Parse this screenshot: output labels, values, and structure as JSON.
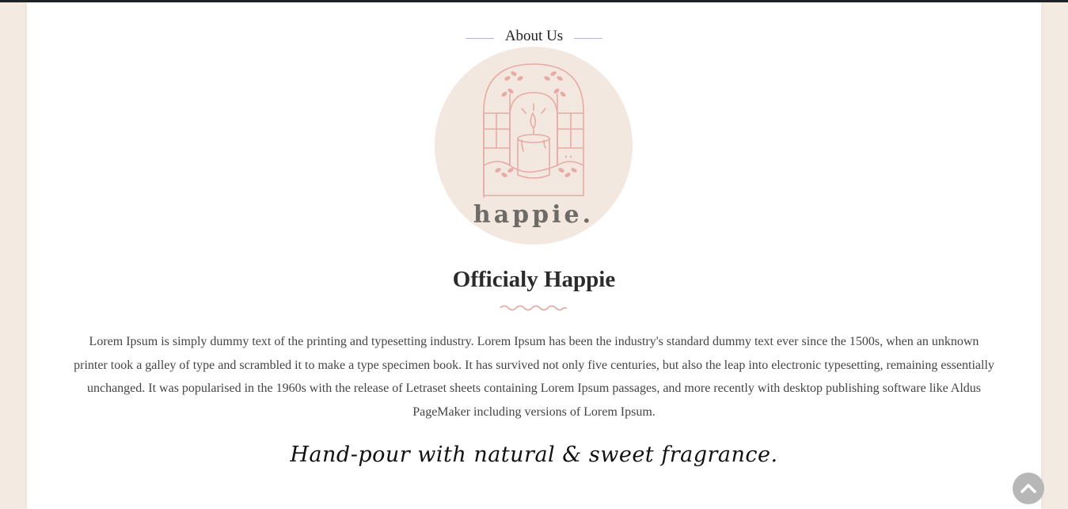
{
  "about": {
    "section_label": "About Us",
    "logo_wordmark": "happie.",
    "title": "Officialy Happie",
    "body": "Lorem Ipsum is simply dummy text of the printing and typesetting industry. Lorem Ipsum has been the industry's standard dummy text ever since the 1500s, when an unknown printer took a galley of type and scrambled it to make a type specimen book. It has survived not only five centuries, but also the leap into electronic typesetting, remaining essentially unchanged. It was popularised in the 1960s with the release of Letraset sheets containing Lorem Ipsum passages, and more recently with desktop publishing software like Aldus PageMaker including versions of Lorem Ipsum.",
    "tagline": "Hand-pour with natural & sweet fragrance."
  },
  "scroll_top": {
    "icon": "chevron-up-icon"
  },
  "colors": {
    "page_background": "#f3ebe2",
    "logo_circle": "#f2e8df",
    "logo_accent": "#e8aaa4",
    "logo_text": "#6e6a66",
    "divider_line": "#b9b5d6",
    "wave_accent": "#e8aaa4",
    "scroll_button": "#b7b7b7"
  }
}
